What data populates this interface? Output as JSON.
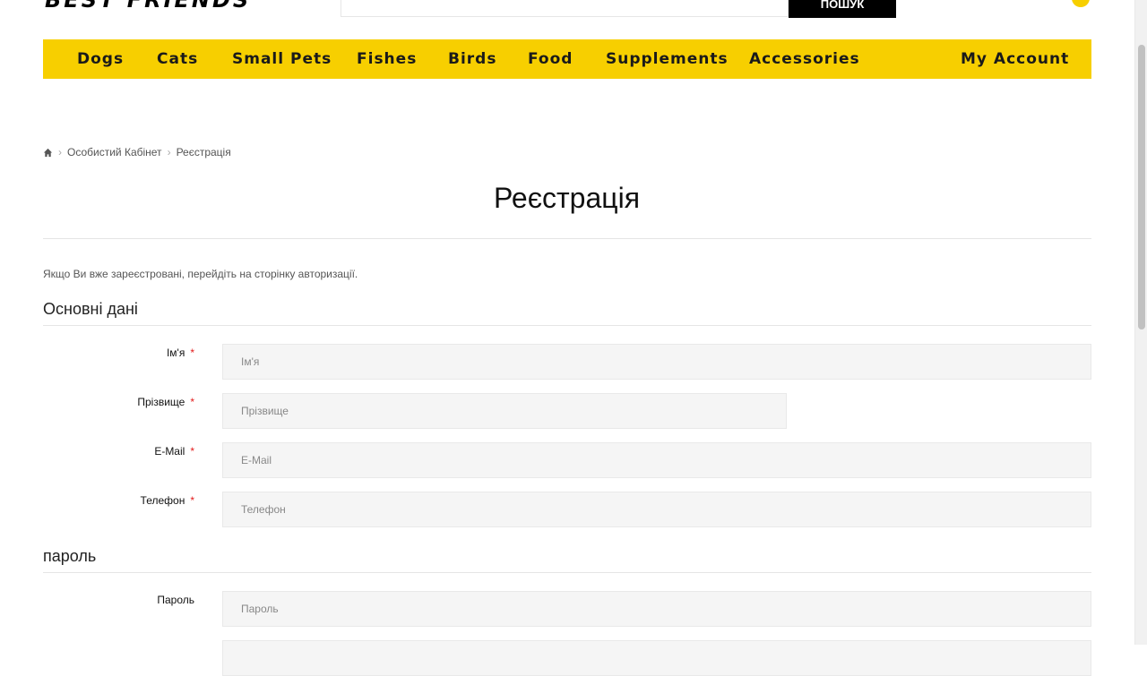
{
  "header": {
    "logo_text": "BEST FRIENDS",
    "search_button_label": "ПОШУК"
  },
  "nav": {
    "items": [
      "Dogs",
      "Cats",
      "Small Pets",
      "Fishes",
      "Birds",
      "Food",
      "Supplements",
      "Accessories"
    ],
    "account_label": "My Account"
  },
  "breadcrumb": {
    "icon": "home-icon",
    "items": [
      "Особистий Кабінет",
      "Реєстрація"
    ]
  },
  "page": {
    "title": "Реєстрація",
    "intro": "Якщо Ви вже зареєстровані, перейдіть на сторінку авторизації."
  },
  "section_personal": {
    "title": "Основні дані",
    "first_name": {
      "label": "Ім'я",
      "required": "*",
      "placeholder": "Ім'я"
    },
    "last_name": {
      "label": "Прізвище",
      "required": "*",
      "placeholder": "Прізвище"
    },
    "email": {
      "label": "E-Mail",
      "required": "*",
      "placeholder": "E-Mail"
    },
    "phone": {
      "label": "Телефон",
      "required": "*",
      "placeholder": "Телефон"
    }
  },
  "section_password": {
    "title": "пароль",
    "password": {
      "label": "Пароль",
      "placeholder": "Пароль"
    }
  },
  "colors": {
    "nav_bg": "#f7cf00",
    "required": "#e31b1b",
    "field_bg": "#f5f5f5"
  }
}
